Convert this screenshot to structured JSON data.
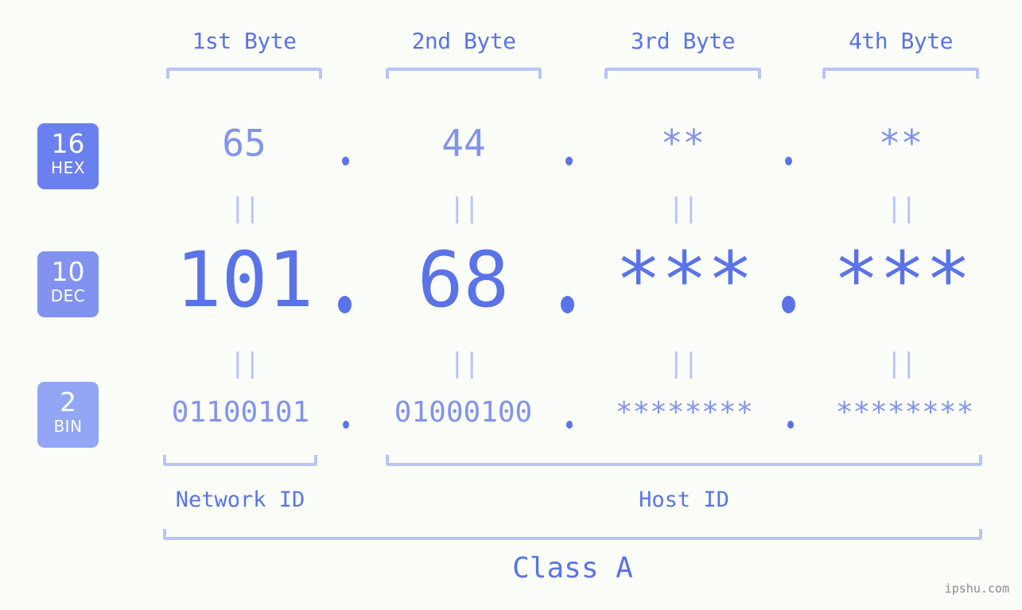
{
  "meta": {
    "watermark": "ipshu.com",
    "background_color": "#fbfdf9",
    "accent_color": "#5a73e8",
    "accent_light_color": "#8193ec",
    "rule_color": "#b9c4f7"
  },
  "columns": [
    {
      "header": "1st Byte"
    },
    {
      "header": "2nd Byte"
    },
    {
      "header": "3rd Byte"
    },
    {
      "header": "4th Byte"
    }
  ],
  "bases": [
    {
      "number": "16",
      "label": "HEX",
      "color": "#6b80ef"
    },
    {
      "number": "10",
      "label": "DEC",
      "color": "#8193ef"
    },
    {
      "number": "2",
      "label": "BIN",
      "color": "#92a6f5"
    }
  ],
  "rows": {
    "hex": {
      "base_number": "16",
      "base_label": "HEX",
      "values": [
        "65",
        "44",
        "**",
        "**"
      ],
      "separator": "."
    },
    "dec": {
      "base_number": "10",
      "base_label": "DEC",
      "values": [
        "101",
        "68",
        "***",
        "***"
      ],
      "separator": "."
    },
    "bin": {
      "base_number": "2",
      "base_label": "BIN",
      "values": [
        "01100101",
        "01000100",
        "********",
        "********"
      ],
      "separator": "."
    }
  },
  "equals_marks": [
    "||",
    "||",
    "||",
    "||",
    "||",
    "||",
    "||",
    "||"
  ],
  "sections": {
    "network_id": "Network ID",
    "host_id": "Host ID",
    "class": "Class A"
  }
}
